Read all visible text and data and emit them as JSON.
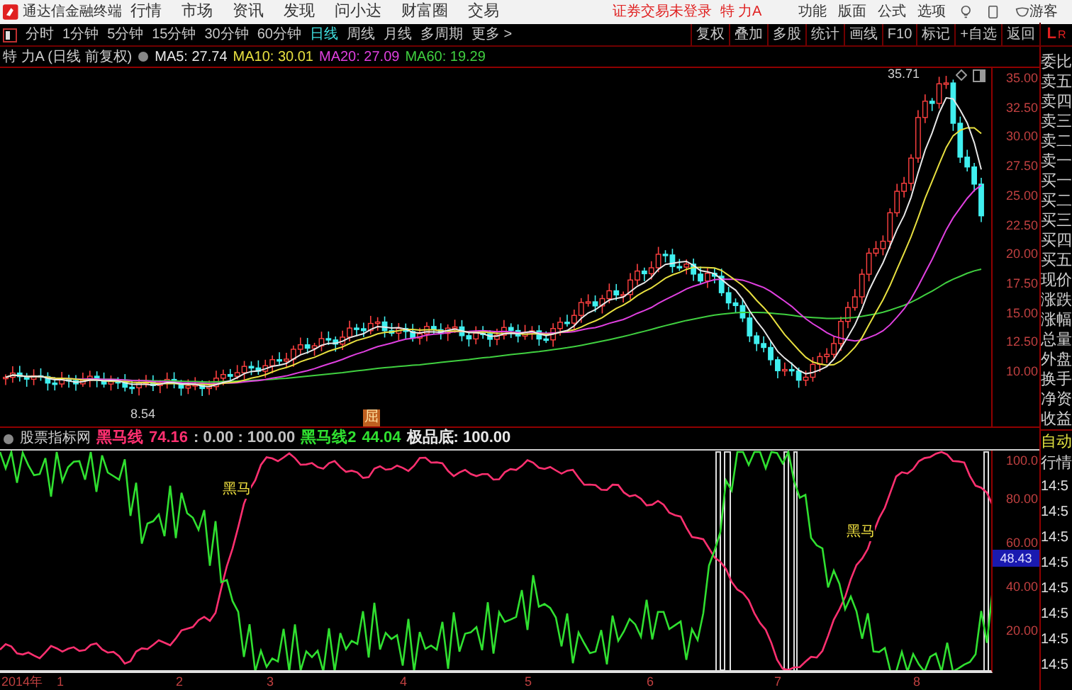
{
  "app": {
    "title": "通达信金融终端",
    "menu": [
      "行情",
      "市场",
      "资讯",
      "发现",
      "问小达",
      "财富圈",
      "交易"
    ],
    "login_notice": "证券交易未登录",
    "stock_name": "特 力A",
    "right_menu": [
      "功能",
      "版面",
      "公式",
      "选项"
    ],
    "user": "游客"
  },
  "period_tabs": [
    {
      "label": "分时",
      "selected": false
    },
    {
      "label": "1分钟",
      "selected": false
    },
    {
      "label": "5分钟",
      "selected": false
    },
    {
      "label": "15分钟",
      "selected": false
    },
    {
      "label": "30分钟",
      "selected": false
    },
    {
      "label": "60分钟",
      "selected": false
    },
    {
      "label": "日线",
      "selected": true
    },
    {
      "label": "周线",
      "selected": false
    },
    {
      "label": "月线",
      "selected": false
    },
    {
      "label": "多周期",
      "selected": false
    },
    {
      "label": "更多 >",
      "selected": false
    }
  ],
  "tools": [
    "复权",
    "叠加",
    "多股",
    "统计",
    "画线",
    "F10",
    "标记",
    "+自选",
    "返回"
  ],
  "brand_marks": [
    "L",
    "R"
  ],
  "quote_header": {
    "stock": "特 力A (日线 前复权)",
    "ma": [
      {
        "label": "MA5: 27.74",
        "color": "#e8e8e8"
      },
      {
        "label": "MA10: 30.01",
        "color": "#e8e040"
      },
      {
        "label": "MA20: 27.09",
        "color": "#e040e0"
      },
      {
        "label": "MA60: 19.29",
        "color": "#40d040"
      }
    ]
  },
  "price_chart": {
    "axis": [
      "35.00",
      "32.50",
      "30.00",
      "27.50",
      "25.00",
      "22.50",
      "20.00",
      "17.50",
      "15.00",
      "12.50",
      "10.00"
    ],
    "high_label": "35.71",
    "low_label": "8.54",
    "marker": "屈"
  },
  "indicator": {
    "source": "股票指标网",
    "readings": [
      {
        "text": "黑马线",
        "color": "#ff3070"
      },
      {
        "text": "74.16",
        "color": "#ff3070"
      },
      {
        "text": ": 0.00 : 100.00",
        "color": "#c0c0c0"
      },
      {
        "text": "黑马线2",
        "color": "#30e030"
      },
      {
        "text": "44.04",
        "color": "#30e030"
      },
      {
        "text": "极品底: 100.00",
        "color": "#e8e8e8"
      }
    ],
    "axis": [
      "100.0",
      "80.00",
      "60.00",
      "40.00",
      "20.00"
    ],
    "current": "48.43",
    "signals": [
      "黑马",
      "黑马"
    ]
  },
  "time_axis": [
    "2014年",
    "1",
    "2",
    "3",
    "4",
    "5",
    "6",
    "7",
    "8"
  ],
  "side_panel": {
    "labels": [
      "委比",
      "卖五",
      "卖四",
      "卖三",
      "卖二",
      "卖一",
      "买一",
      "买二",
      "买三",
      "买四",
      "买五",
      "现价",
      "涨跌",
      "涨幅",
      "总量",
      "外盘",
      "换手",
      "净资",
      "收益"
    ],
    "auto": "自动",
    "quote": "行情",
    "times": [
      "14:5",
      "14:5",
      "14:5",
      "14:5",
      "14:5",
      "14:5",
      "14:5",
      "14:5"
    ]
  }
}
